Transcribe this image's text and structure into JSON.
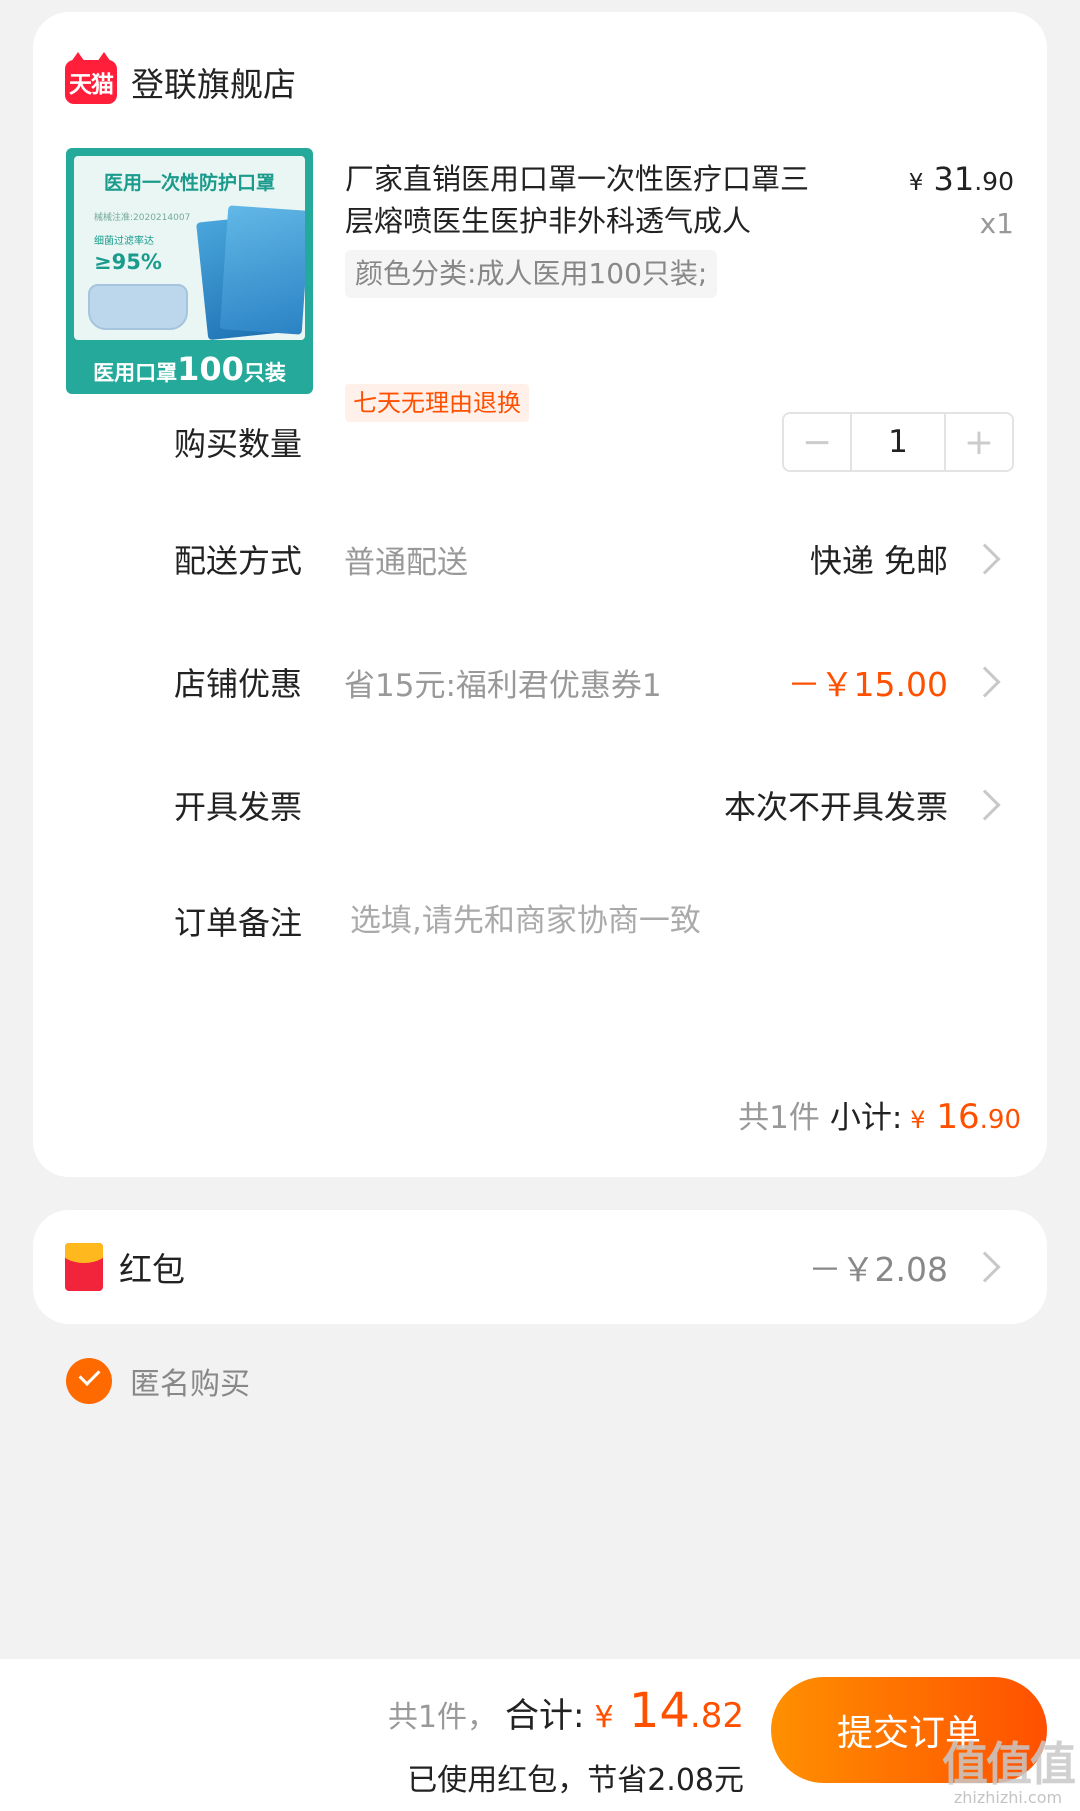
{
  "store": {
    "logo_text": "天猫",
    "name": "登联旗舰店"
  },
  "product": {
    "image": {
      "title": "医用一次性防护口罩",
      "note": "械械注准:2020214007",
      "rate_label": "细菌过滤率达",
      "rate": "≥95%",
      "bottom_prefix": "医用口罩",
      "bottom_number": "100",
      "bottom_suffix": "只装"
    },
    "title": "厂家直销医用口罩一次性医疗口罩三层熔喷医生医护非外科透气成人",
    "price_symbol": "¥",
    "price_int": "31",
    "price_dec": ".90",
    "quantity": "x1",
    "sku": "颜色分类:成人医用100只装;",
    "return_tag": "七天无理由退换"
  },
  "quantity_row": {
    "label": "购买数量",
    "minus": "−",
    "value": "1",
    "plus": "+"
  },
  "delivery": {
    "label": "配送方式",
    "method": "普通配送",
    "value": "快递 免邮"
  },
  "coupon": {
    "label": "店铺优惠",
    "desc": "省15元:福利君优惠券1",
    "value": "－￥15.00"
  },
  "invoice": {
    "label": "开具发票",
    "value": "本次不开具发票"
  },
  "remark": {
    "label": "订单备注",
    "placeholder": "选填,请先和商家协商一致"
  },
  "subtotal": {
    "count": "共1件",
    "label": "小计:",
    "symbol": "¥",
    "int": "16",
    "dec": ".90"
  },
  "red_packet": {
    "label": "红包",
    "value": "－￥2.08"
  },
  "anonymous": {
    "label": "匿名购买",
    "checked": true
  },
  "footer": {
    "count": "共1件，",
    "total_label": "合计:",
    "symbol": "¥",
    "total_int": "14",
    "total_dec": ".82",
    "saved": "已使用红包，节省2.08元",
    "submit": "提交订单",
    "watermark_logo": "值值值",
    "watermark_url": "zhizhizhi.com"
  },
  "colors": {
    "accent": "#ff5000",
    "button_gradient_start": "#ff9000",
    "tmall_red": "#ff1f3a",
    "product_teal": "#25a99a"
  }
}
